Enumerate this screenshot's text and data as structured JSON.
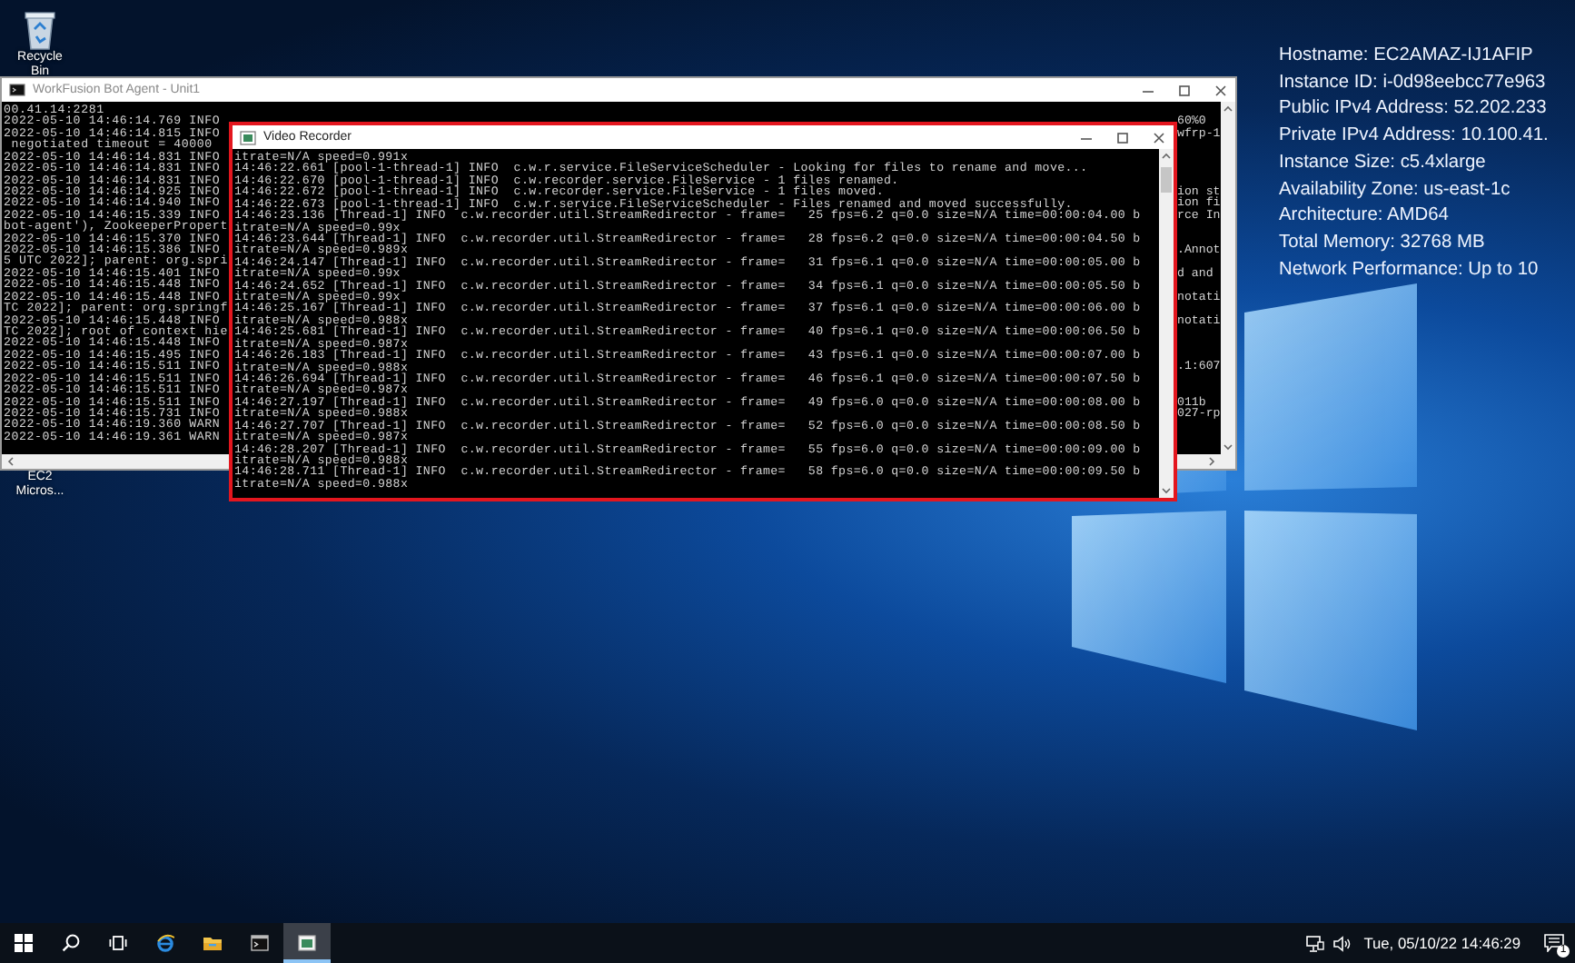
{
  "desktop_icons": [
    {
      "kind": "recycle-bin",
      "label": "Recycle Bin"
    },
    {
      "kind": "shortcut",
      "label": "EC2 Micros..."
    }
  ],
  "system_info": [
    "Hostname: EC2AMAZ-IJ1AFIP",
    "Instance ID: i-0d98eebcc77e963",
    "Public IPv4 Address: 52.202.233",
    "Private IPv4 Address: 10.100.41.",
    "Instance Size: c5.4xlarge",
    "Availability Zone: us-east-1c",
    "Architecture: AMD64",
    "Total Memory: 32768 MB",
    "Network Performance: Up to 10"
  ],
  "console_window": {
    "title": "WorkFusion Bot Agent - Unit1",
    "active": false,
    "lines": [
      {
        "text": "00.41.14:2281"
      },
      {
        "text": "2022-05-10 14:46:14.769 INFO",
        "tail": "60%0"
      },
      {
        "text": "2022-05-10 14:46:14.815 INFO",
        "tail": "wfrp-1"
      },
      {
        "text": " negotiated timeout = 40000"
      },
      {
        "text": "2022-05-10 14:46:14.831 INFO"
      },
      {
        "text": "2022-05-10 14:46:14.831 INFO"
      },
      {
        "text": "2022-05-10 14:46:14.831 INFO"
      },
      {
        "text": "2022-05-10 14:46:14.925 INFO",
        "tail": "ion st"
      },
      {
        "text": "2022-05-10 14:46:14.940 INFO",
        "tail": "ion fi"
      },
      {
        "text": "2022-05-10 14:46:15.339 INFO",
        "tail": "rce In"
      },
      {
        "text": "bot-agent'), ZookeeperPropert"
      },
      {
        "text": "2022-05-10 14:46:15.370 INFO"
      },
      {
        "text": "2022-05-10 14:46:15.386 INFO",
        "tail": ".Annot"
      },
      {
        "text": "5 UTC 2022]; parent: org.spri"
      },
      {
        "text": "2022-05-10 14:46:15.401 INFO",
        "tail": "d and"
      },
      {
        "text": "2022-05-10 14:46:15.448 INFO"
      },
      {
        "text": "2022-05-10 14:46:15.448 INFO",
        "tail": "notati"
      },
      {
        "text": "TC 2022]; parent: org.springf"
      },
      {
        "text": "2022-05-10 14:46:15.448 INFO",
        "tail": "notati"
      },
      {
        "text": "TC 2022]; root of context hie"
      },
      {
        "text": "2022-05-10 14:46:15.448 INFO"
      },
      {
        "text": "2022-05-10 14:46:15.495 INFO"
      },
      {
        "text": "2022-05-10 14:46:15.511 INFO",
        "tail": ".1:607"
      },
      {
        "text": "2022-05-10 14:46:15.511 INFO"
      },
      {
        "text": "2022-05-10 14:46:15.511 INFO"
      },
      {
        "text": "2022-05-10 14:46:15.511 INFO",
        "tail": "011b"
      },
      {
        "text": "2022-05-10 14:46:15.731 INFO",
        "tail": "027-rp"
      },
      {
        "text": "2022-05-10 14:46:19.360 WARN"
      },
      {
        "text": "2022-05-10 14:46:19.361 WARN"
      }
    ]
  },
  "recorder_window": {
    "title": "Video Recorder",
    "active": true,
    "highlighted": true,
    "lines": [
      "itrate=N/A speed=0.991x",
      "14:46:22.661 [pool-1-thread-1] INFO  c.w.r.service.FileServiceScheduler - Looking for files to rename and move...",
      "14:46:22.670 [pool-1-thread-1] INFO  c.w.recorder.service.FileService - 1 files renamed.",
      "14:46:22.672 [pool-1-thread-1] INFO  c.w.recorder.service.FileService - 1 files moved.",
      "14:46:22.673 [pool-1-thread-1] INFO  c.w.r.service.FileServiceScheduler - Files renamed and moved successfully.",
      "14:46:23.136 [Thread-1] INFO  c.w.recorder.util.StreamRedirector - frame=   25 fps=6.2 q=0.0 size=N/A time=00:00:04.00 b",
      "itrate=N/A speed=0.99x",
      "14:46:23.644 [Thread-1] INFO  c.w.recorder.util.StreamRedirector - frame=   28 fps=6.2 q=0.0 size=N/A time=00:00:04.50 b",
      "itrate=N/A speed=0.989x",
      "14:46:24.147 [Thread-1] INFO  c.w.recorder.util.StreamRedirector - frame=   31 fps=6.1 q=0.0 size=N/A time=00:00:05.00 b",
      "itrate=N/A speed=0.99x",
      "14:46:24.652 [Thread-1] INFO  c.w.recorder.util.StreamRedirector - frame=   34 fps=6.1 q=0.0 size=N/A time=00:00:05.50 b",
      "itrate=N/A speed=0.99x",
      "14:46:25.167 [Thread-1] INFO  c.w.recorder.util.StreamRedirector - frame=   37 fps=6.1 q=0.0 size=N/A time=00:00:06.00 b",
      "itrate=N/A speed=0.988x",
      "14:46:25.681 [Thread-1] INFO  c.w.recorder.util.StreamRedirector - frame=   40 fps=6.1 q=0.0 size=N/A time=00:00:06.50 b",
      "itrate=N/A speed=0.987x",
      "14:46:26.183 [Thread-1] INFO  c.w.recorder.util.StreamRedirector - frame=   43 fps=6.1 q=0.0 size=N/A time=00:00:07.00 b",
      "itrate=N/A speed=0.988x",
      "14:46:26.694 [Thread-1] INFO  c.w.recorder.util.StreamRedirector - frame=   46 fps=6.1 q=0.0 size=N/A time=00:00:07.50 b",
      "itrate=N/A speed=0.987x",
      "14:46:27.197 [Thread-1] INFO  c.w.recorder.util.StreamRedirector - frame=   49 fps=6.0 q=0.0 size=N/A time=00:00:08.00 b",
      "itrate=N/A speed=0.988x",
      "14:46:27.707 [Thread-1] INFO  c.w.recorder.util.StreamRedirector - frame=   52 fps=6.0 q=0.0 size=N/A time=00:00:08.50 b",
      "itrate=N/A speed=0.987x",
      "14:46:28.207 [Thread-1] INFO  c.w.recorder.util.StreamRedirector - frame=   55 fps=6.0 q=0.0 size=N/A time=00:00:09.00 b",
      "itrate=N/A speed=0.988x",
      "14:46:28.711 [Thread-1] INFO  c.w.recorder.util.StreamRedirector - frame=   58 fps=6.0 q=0.0 size=N/A time=00:00:09.50 b",
      "itrate=N/A speed=0.988x"
    ]
  },
  "taskbar": {
    "apps": [
      {
        "kind": "start",
        "selected": false
      },
      {
        "kind": "search",
        "selected": false
      },
      {
        "kind": "task-view",
        "selected": false
      },
      {
        "kind": "browser",
        "selected": false
      },
      {
        "kind": "file-explorer",
        "selected": false
      },
      {
        "kind": "console",
        "selected": false
      },
      {
        "kind": "recorder",
        "selected": true
      }
    ],
    "clock": "Tue, 05/10/22 14:46:29",
    "notification_count": "1"
  }
}
